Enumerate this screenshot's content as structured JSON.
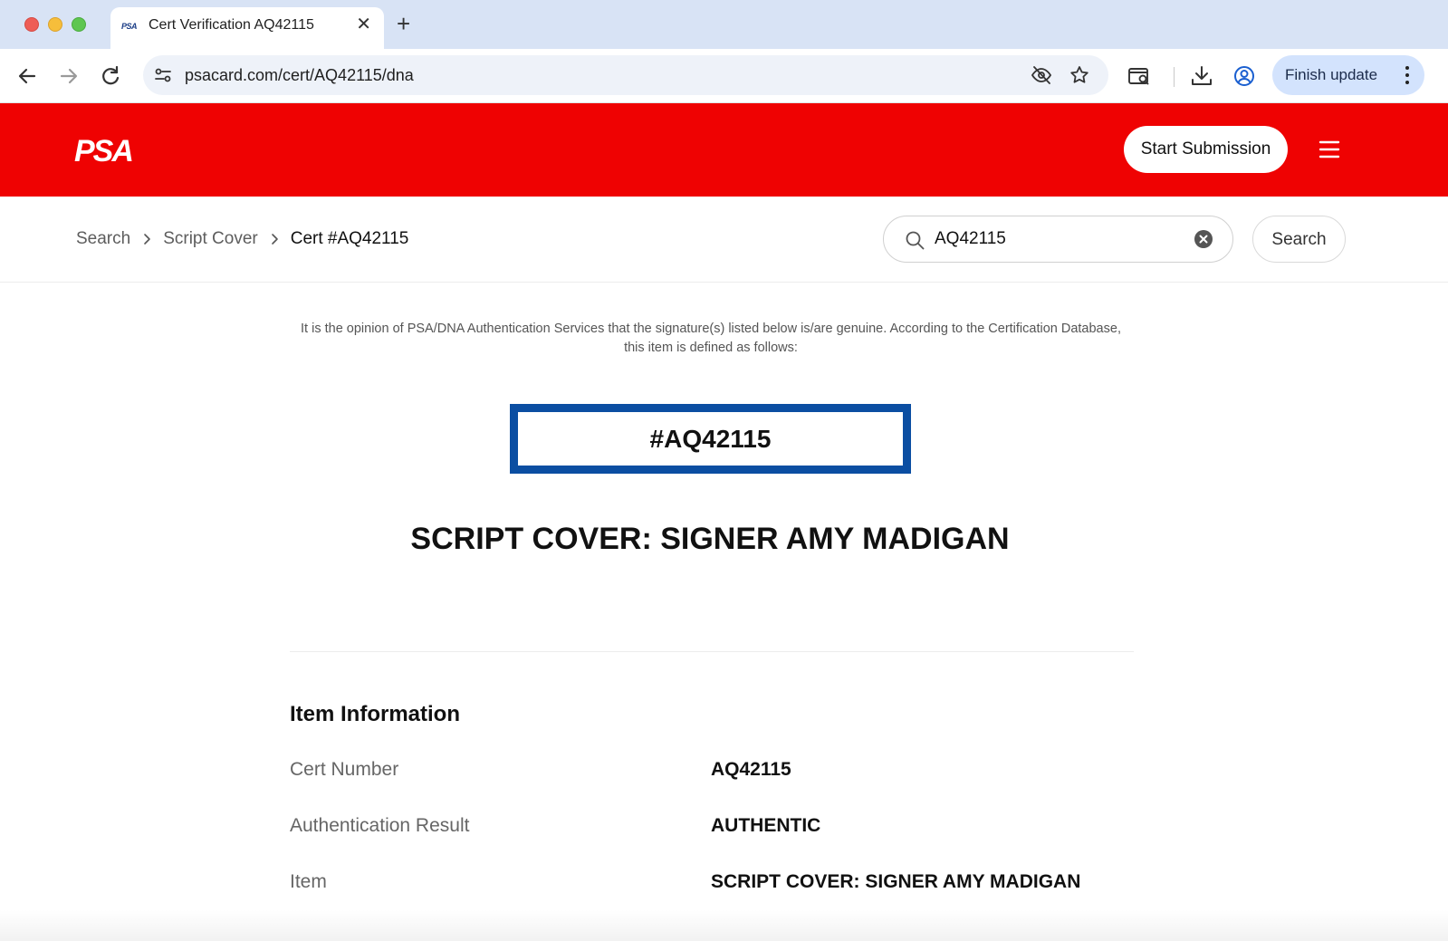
{
  "browser": {
    "tab_title": "Cert Verification AQ42115",
    "tab_favicon_text": "PSA",
    "url": "psacard.com/cert/AQ42115/dna",
    "finish_update_label": "Finish update"
  },
  "header": {
    "logo_text": "PSA",
    "start_submission_label": "Start Submission",
    "brand_color": "#ef0202"
  },
  "breadcrumb": {
    "items": [
      "Search",
      "Script Cover",
      "Cert #AQ42115"
    ]
  },
  "search": {
    "value": "AQ42115",
    "button_label": "Search"
  },
  "main": {
    "opinion_text": "It is the opinion of PSA/DNA Authentication Services that the signature(s) listed below is/are genuine. According to the Certification Database, this item is defined as follows:",
    "cert_display": "#AQ42115",
    "cert_box_color": "#0b4ea2",
    "item_title": "SCRIPT COVER: SIGNER AMY MADIGAN",
    "section_heading": "Item Information",
    "info_rows": [
      {
        "label": "Cert Number",
        "value": "AQ42115"
      },
      {
        "label": "Authentication Result",
        "value": "AUTHENTIC"
      },
      {
        "label": "Item",
        "value": "SCRIPT COVER: SIGNER AMY MADIGAN"
      }
    ]
  }
}
